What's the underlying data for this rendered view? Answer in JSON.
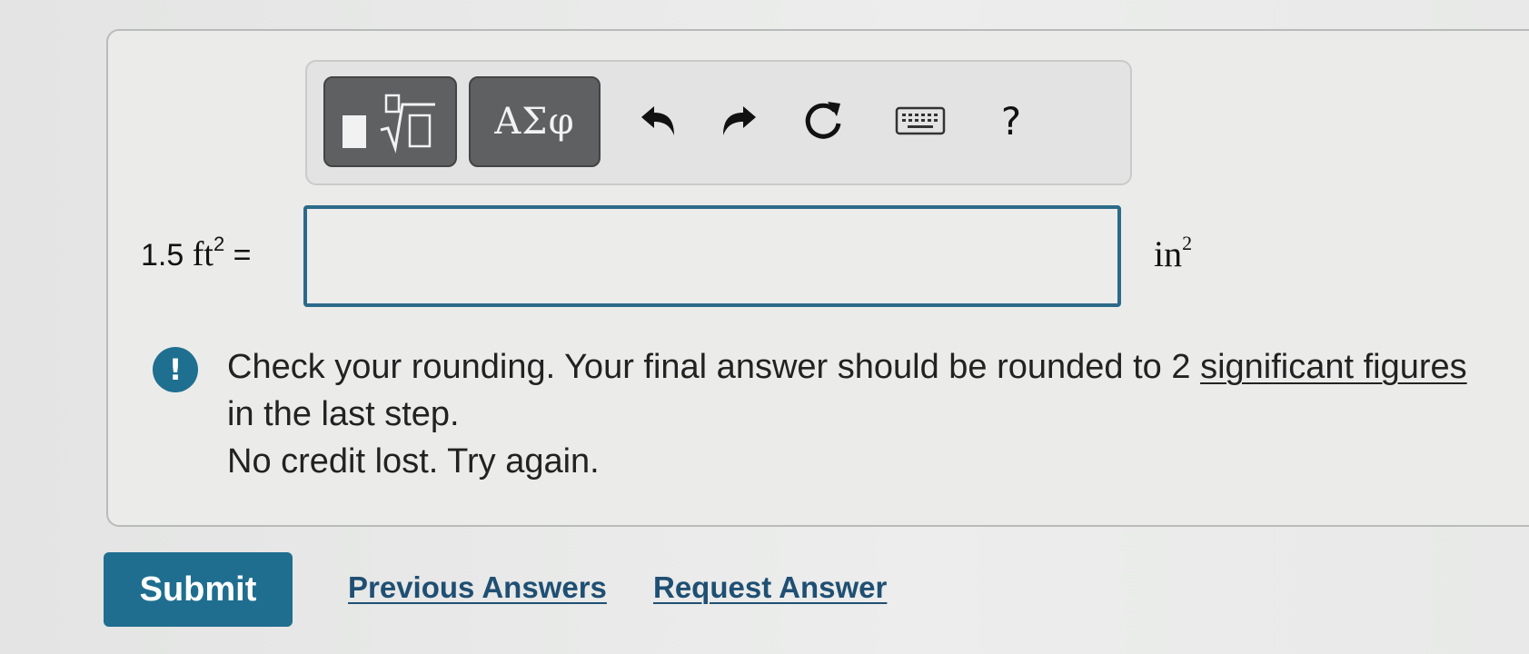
{
  "toolbar": {
    "greek_label": "ΑΣφ",
    "help_label": "?",
    "icons": [
      "templates-icon",
      "undo-icon",
      "redo-icon",
      "reset-icon",
      "keyboard-icon",
      "help-icon"
    ]
  },
  "equation": {
    "lhs_value": "1.5",
    "lhs_unit": "ft",
    "lhs_exponent": "2",
    "equals": "=",
    "answer_value": "",
    "rhs_unit": "in",
    "rhs_exponent": "2"
  },
  "feedback": {
    "icon": "!",
    "line1_before_link": "Check your rounding. Your final answer should be rounded to 2 ",
    "link_text": "significant figures",
    "line1_after_link": " in the last step.",
    "line2": "No credit lost. Try again."
  },
  "actions": {
    "submit_label": "Submit",
    "previous_answers_label": "Previous Answers",
    "request_answer_label": "Request Answer"
  },
  "colors": {
    "accent": "#1f6e8f",
    "input_border": "#2c6a8a",
    "toolbar_button": "#5e6062",
    "link": "#1f4f73"
  }
}
